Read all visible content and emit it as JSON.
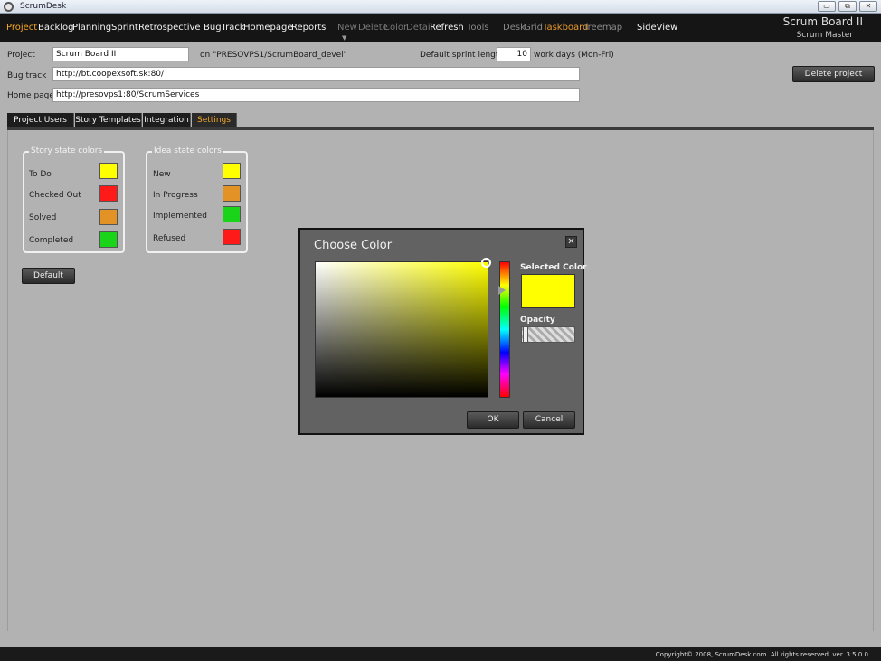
{
  "window": {
    "title": "ScrumDesk",
    "minimize": "▭",
    "restore": "⧉",
    "close": "✕"
  },
  "menu": {
    "items": [
      "Project",
      "Backlog",
      "Planning",
      "Sprint",
      "Retrospective",
      "BugTrack",
      "Homepage",
      "Reports",
      "New",
      "Delete",
      "Color",
      "Detail",
      "Refresh",
      "Tools",
      "Desk",
      "Grid",
      "Taskboard",
      "Treemap",
      "SideView"
    ],
    "active": "Project",
    "board_title": "Scrum Board II",
    "role": "Scrum Master"
  },
  "form": {
    "project_label": "Project",
    "project_value": "Scrum Board II",
    "location_text": "on \"PRESOVPS1/ScrumBoard_devel\"",
    "sprint_label": "Default sprint length",
    "sprint_value": "10",
    "sprint_unit": "work days (Mon-Fri)",
    "bugtrack_label": "Bug track",
    "bugtrack_value": "http://bt.coopexsoft.sk:80/",
    "homepage_label": "Home page",
    "homepage_value": "http://presovps1:80/ScrumServices",
    "delete_button": "Delete project"
  },
  "tabs": [
    {
      "label": "Project Users"
    },
    {
      "label": "Story Templates"
    },
    {
      "label": "Integration"
    },
    {
      "label": "Settings"
    }
  ],
  "active_tab": "Settings",
  "story_colors": {
    "title": "Story state colors",
    "rows": [
      {
        "label": "To Do",
        "color": "#ffff00"
      },
      {
        "label": "Checked Out",
        "color": "#ff1a1a"
      },
      {
        "label": "Solved",
        "color": "#e39226"
      },
      {
        "label": "Completed",
        "color": "#1ad41a"
      }
    ]
  },
  "idea_colors": {
    "title": "Idea state colors",
    "rows": [
      {
        "label": "New",
        "color": "#ffff00"
      },
      {
        "label": "In Progress",
        "color": "#e39226"
      },
      {
        "label": "Implemented",
        "color": "#1ad41a"
      },
      {
        "label": "Refused",
        "color": "#ff1a1a"
      }
    ]
  },
  "default_button": "Default",
  "dialog": {
    "title": "Choose Color",
    "close": "✕",
    "selected_color_label": "Selected Color",
    "selected_color": "#ffff00",
    "opacity_label": "Opacity",
    "ok": "OK",
    "cancel": "Cancel"
  },
  "footer": {
    "copyright": "Copyright© 2008, ScrumDesk.com. All rights reserved. ver. 3.5.0.0"
  }
}
